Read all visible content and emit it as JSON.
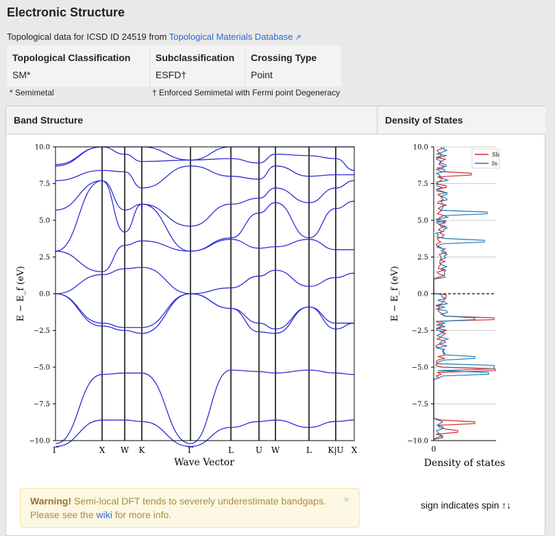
{
  "header": {
    "title": "Electronic Structure"
  },
  "source": {
    "prefix": "Topological data for ICSD ID 24519 from",
    "link": "Topological Materials Database",
    "icon": "external-link-icon"
  },
  "classification": {
    "columns": [
      {
        "header": "Topological Classification",
        "value": "SM*"
      },
      {
        "header": "Subclassification",
        "value": "ESFD†"
      },
      {
        "header": "Crossing Type",
        "value": "Point"
      }
    ],
    "note_star": "* Semimetal",
    "note_dagger": "† Enforced Semimetal with Fermi point Degeneracy"
  },
  "panels": {
    "band": "Band Structure",
    "dos": "Density of States"
  },
  "band_plot": {
    "ylabel": "E  −  E_f (eV)",
    "xlabel": "Wave Vector",
    "yticks": [
      "10.0",
      "7.5",
      "5.0",
      "2.5",
      "0.0",
      "−2.5",
      "−5.0",
      "−7.5",
      "−10.0"
    ],
    "kpoints": [
      "Γ",
      "X",
      "W",
      "K",
      "Γ",
      "L",
      "U",
      "W",
      "L",
      "K|U",
      "X"
    ]
  },
  "dos_plot": {
    "ylabel": "E  −  E_f (eV)",
    "xlabel": "Density of states",
    "xtick": "0",
    "legend": [
      "Sb",
      "In"
    ],
    "colors": {
      "Sb": "#d62728",
      "In": "#1f77b4"
    }
  },
  "chart_data": [
    {
      "type": "line",
      "title": "Band Structure",
      "xlabel": "Wave Vector",
      "ylabel": "E − Ef (eV)",
      "ylim": [
        -10,
        10
      ],
      "kpath": [
        "Γ",
        "X",
        "W",
        "K",
        "Γ",
        "L",
        "U",
        "W",
        "L",
        "K|U",
        "X"
      ],
      "fermi_level": 0.0,
      "notable_energies": {
        "valence_top_at_Gamma": 0.0,
        "deep_band_range": [
          -10.0,
          -8.5
        ],
        "band_near_minus_5_5": -5.5
      }
    },
    {
      "type": "line",
      "title": "Density of States",
      "xlabel": "Density of states",
      "ylabel": "E − Ef (eV)",
      "ylim": [
        -10,
        10
      ],
      "series": [
        {
          "name": "Sb"
        },
        {
          "name": "In"
        }
      ],
      "legend_position": "top-right"
    }
  ],
  "warning": {
    "bold": "Warning!",
    "text": " Semi-local DFT tends to severely underestimate bandgaps.",
    "line2_pre": "Please see the ",
    "link": "wiki",
    "line2_post": " for more info.",
    "close": "×"
  },
  "spin_note": "sign indicates spin ↑↓"
}
